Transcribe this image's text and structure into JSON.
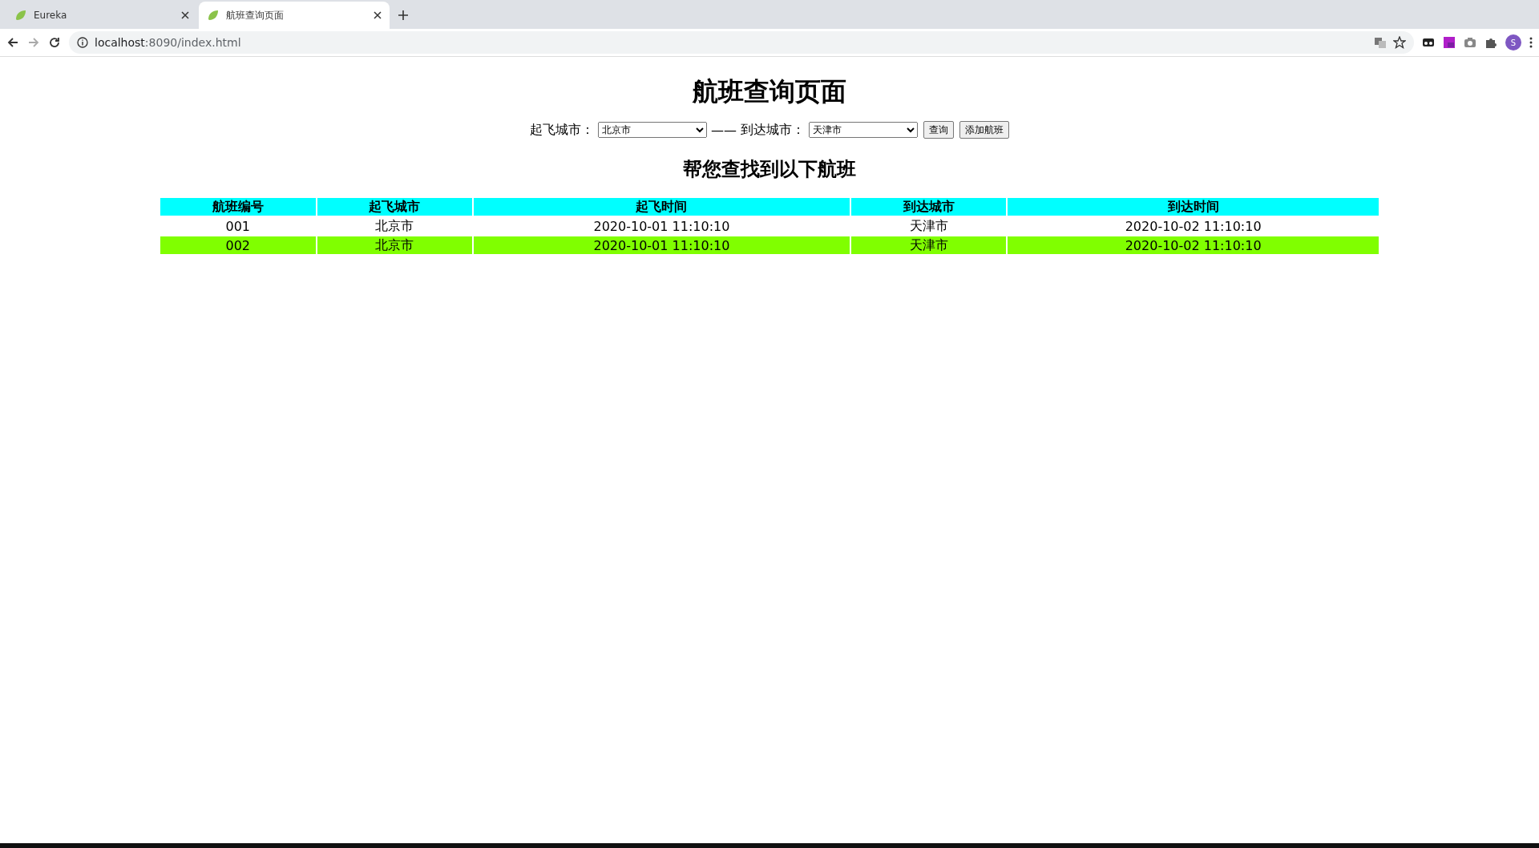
{
  "browser": {
    "tabs": [
      {
        "title": "Eureka",
        "selected": false
      },
      {
        "title": "航班查询页面",
        "selected": true
      }
    ],
    "address": {
      "host": "localhost",
      "rest": ":8090/index.html"
    },
    "avatar": "S"
  },
  "page": {
    "title": "航班查询页面",
    "form": {
      "from_label": "起飞城市：",
      "from_value": "北京市",
      "separator": "——",
      "to_label": "到达城市：",
      "to_value": "天津市",
      "buttons": [
        "查询",
        "添加航班"
      ]
    },
    "subtitle": "帮您查找到以下航班",
    "table": {
      "columns": [
        "航班编号",
        "起飞城市",
        "起飞时间",
        "到达城市",
        "到达时间"
      ],
      "rows": [
        {
          "cells": [
            "001",
            "北京市",
            "2020-10-01 11:10:10",
            "天津市",
            "2020-10-02 11:10:10"
          ],
          "highlighted": false
        },
        {
          "cells": [
            "002",
            "北京市",
            "2020-10-01 11:10:10",
            "天津市",
            "2020-10-02 11:10:10"
          ],
          "highlighted": true
        }
      ]
    }
  }
}
